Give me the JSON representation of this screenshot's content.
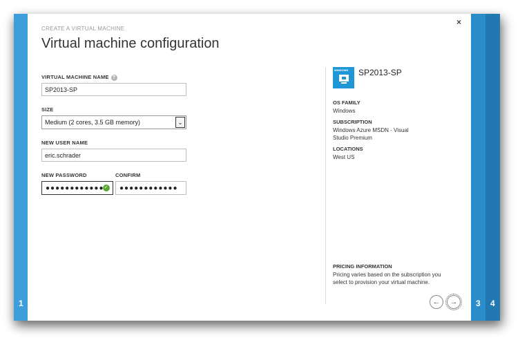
{
  "steps": {
    "left": "1",
    "right_a": "3",
    "right_b": "4"
  },
  "header": {
    "crumb": "CREATE A VIRTUAL MACHINE",
    "title": "Virtual machine configuration",
    "close": "×"
  },
  "form": {
    "vm_name_label": "VIRTUAL MACHINE NAME",
    "vm_name_value": "SP2013-SP",
    "size_label": "SIZE",
    "size_value": "Medium (2 cores, 3.5 GB memory)",
    "user_label": "NEW USER NAME",
    "user_value": "eric.schrader",
    "password_label": "NEW PASSWORD",
    "password_value": "●●●●●●●●●●●●",
    "confirm_label": "CONFIRM",
    "confirm_value": "●●●●●●●●●●●●"
  },
  "summary": {
    "icon_tag": "WINDOWS",
    "vm_name": "SP2013-SP",
    "os_family_label": "OS FAMILY",
    "os_family_value": "Windows",
    "subscription_label": "SUBSCRIPTION",
    "subscription_value_line1": "Windows Azure MSDN - Visual",
    "subscription_value_line2": "Studio Premium",
    "locations_label": "LOCATIONS",
    "locations_value": "West US",
    "pricing_label": "PRICING INFORMATION",
    "pricing_line1": "Pricing varies based on the subscription you",
    "pricing_line2": "select to provision your virtual machine."
  },
  "nav": {
    "back": "←",
    "next": "→"
  },
  "icons": {
    "help": "?",
    "valid": "✓",
    "select_arrow": "⌄"
  },
  "colors": {
    "accent": "#3e9ddb",
    "step3": "#2a8cc8",
    "step4": "#2279b2",
    "valid": "#5aa832"
  }
}
